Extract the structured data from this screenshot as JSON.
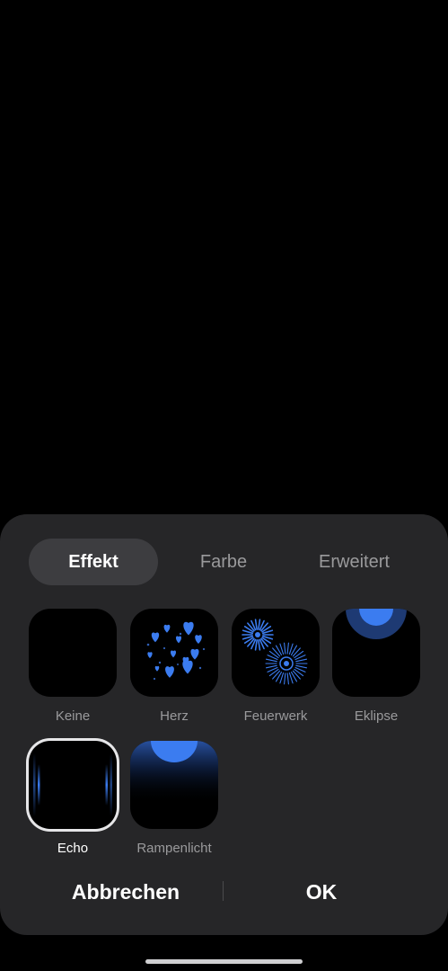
{
  "tabs": [
    {
      "label": "Effekt",
      "active": true
    },
    {
      "label": "Farbe",
      "active": false
    },
    {
      "label": "Erweitert",
      "active": false
    }
  ],
  "effects": [
    {
      "label": "Keine",
      "icon": "none-effect-icon",
      "selected": false
    },
    {
      "label": "Herz",
      "icon": "hearts-effect-icon",
      "selected": false
    },
    {
      "label": "Feuerwerk",
      "icon": "fireworks-effect-icon",
      "selected": false
    },
    {
      "label": "Eklipse",
      "icon": "eclipse-effect-icon",
      "selected": false
    },
    {
      "label": "Echo",
      "icon": "echo-effect-icon",
      "selected": true
    },
    {
      "label": "Rampenlicht",
      "icon": "spotlight-effect-icon",
      "selected": false
    }
  ],
  "buttons": {
    "cancel": "Abbrechen",
    "ok": "OK"
  },
  "colors": {
    "accent": "#3b7cf0",
    "sheet": "#262628",
    "background": "#000000"
  }
}
